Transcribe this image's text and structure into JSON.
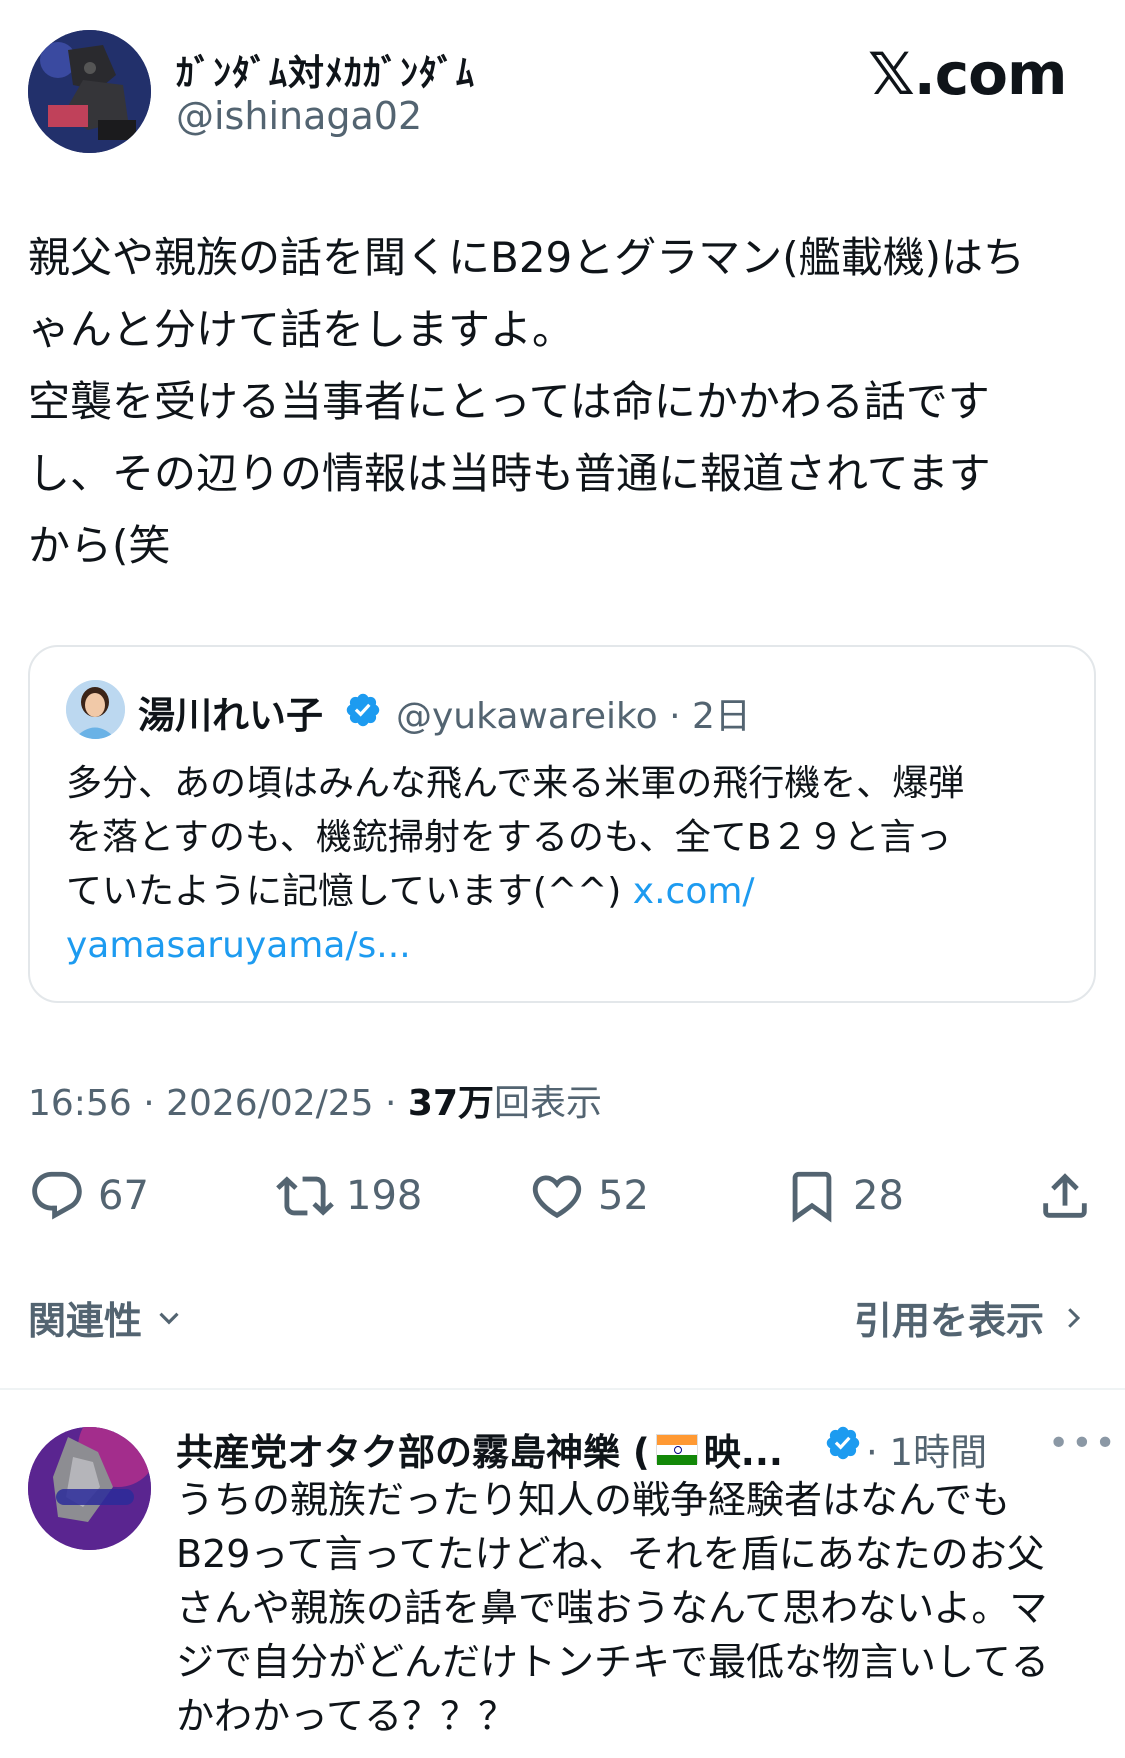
{
  "post": {
    "author": {
      "display_name": "ｶﾞﾝﾀﾞﾑ対ﾒｶｶﾞﾝﾀﾞﾑ",
      "handle": "@ishinaga02"
    },
    "brand": "𝕏.com",
    "text_lines": [
      "親父や親族の話を聞くにB29とグラマン(艦載機)はち",
      "ゃんと分けて話をしますよ。",
      "空襲を受ける当事者にとっては命にかかわる話です",
      "し、その辺りの情報は当時も普通に報道されてます",
      "から(笑"
    ],
    "quote": {
      "name": "湯川れい子",
      "handle_time": "@yukawareiko · 2日",
      "verified_color": "#1d9bf0",
      "text_lines": [
        "多分、あの頃はみんな飛んで来る米軍の飛行機を、爆弾",
        "を落とすのも、機銃掃射をするのも、全てB２９と言っ",
        "ていたように記憶しています(^^) "
      ],
      "link_line3": "x.com/",
      "link_line4": "yamasaruyama/s..."
    },
    "meta": {
      "timestamp": "16:56 · 2026/02/25 · ",
      "views_count": "37万",
      "views_label": "回表示"
    },
    "actions": {
      "replies": "67",
      "reposts": "198",
      "likes": "52",
      "bookmarks": "28"
    },
    "related_label": "関連性",
    "view_quotes_label": "引用を表示"
  },
  "reply": {
    "name_prefix": "共産党オタク部の霧島神樂 (",
    "name_suffix": "映...",
    "time": "· 1時間",
    "more": "•••",
    "text_lines": [
      "うちの親族だったり知人の戦争経験者はなんでも",
      "B29って言ってたけどね、それを盾にあなたのお父",
      "さんや親族の話を鼻で嗤おうなんて思わないよ。マ",
      "ジで自分がどんだけトンチキで最低な物言いしてる",
      "かわかってる？？？"
    ]
  },
  "colors": {
    "accent": "#1d9bf0",
    "muted": "#536471",
    "text": "#0f1419",
    "border": "#e3e7ea"
  }
}
